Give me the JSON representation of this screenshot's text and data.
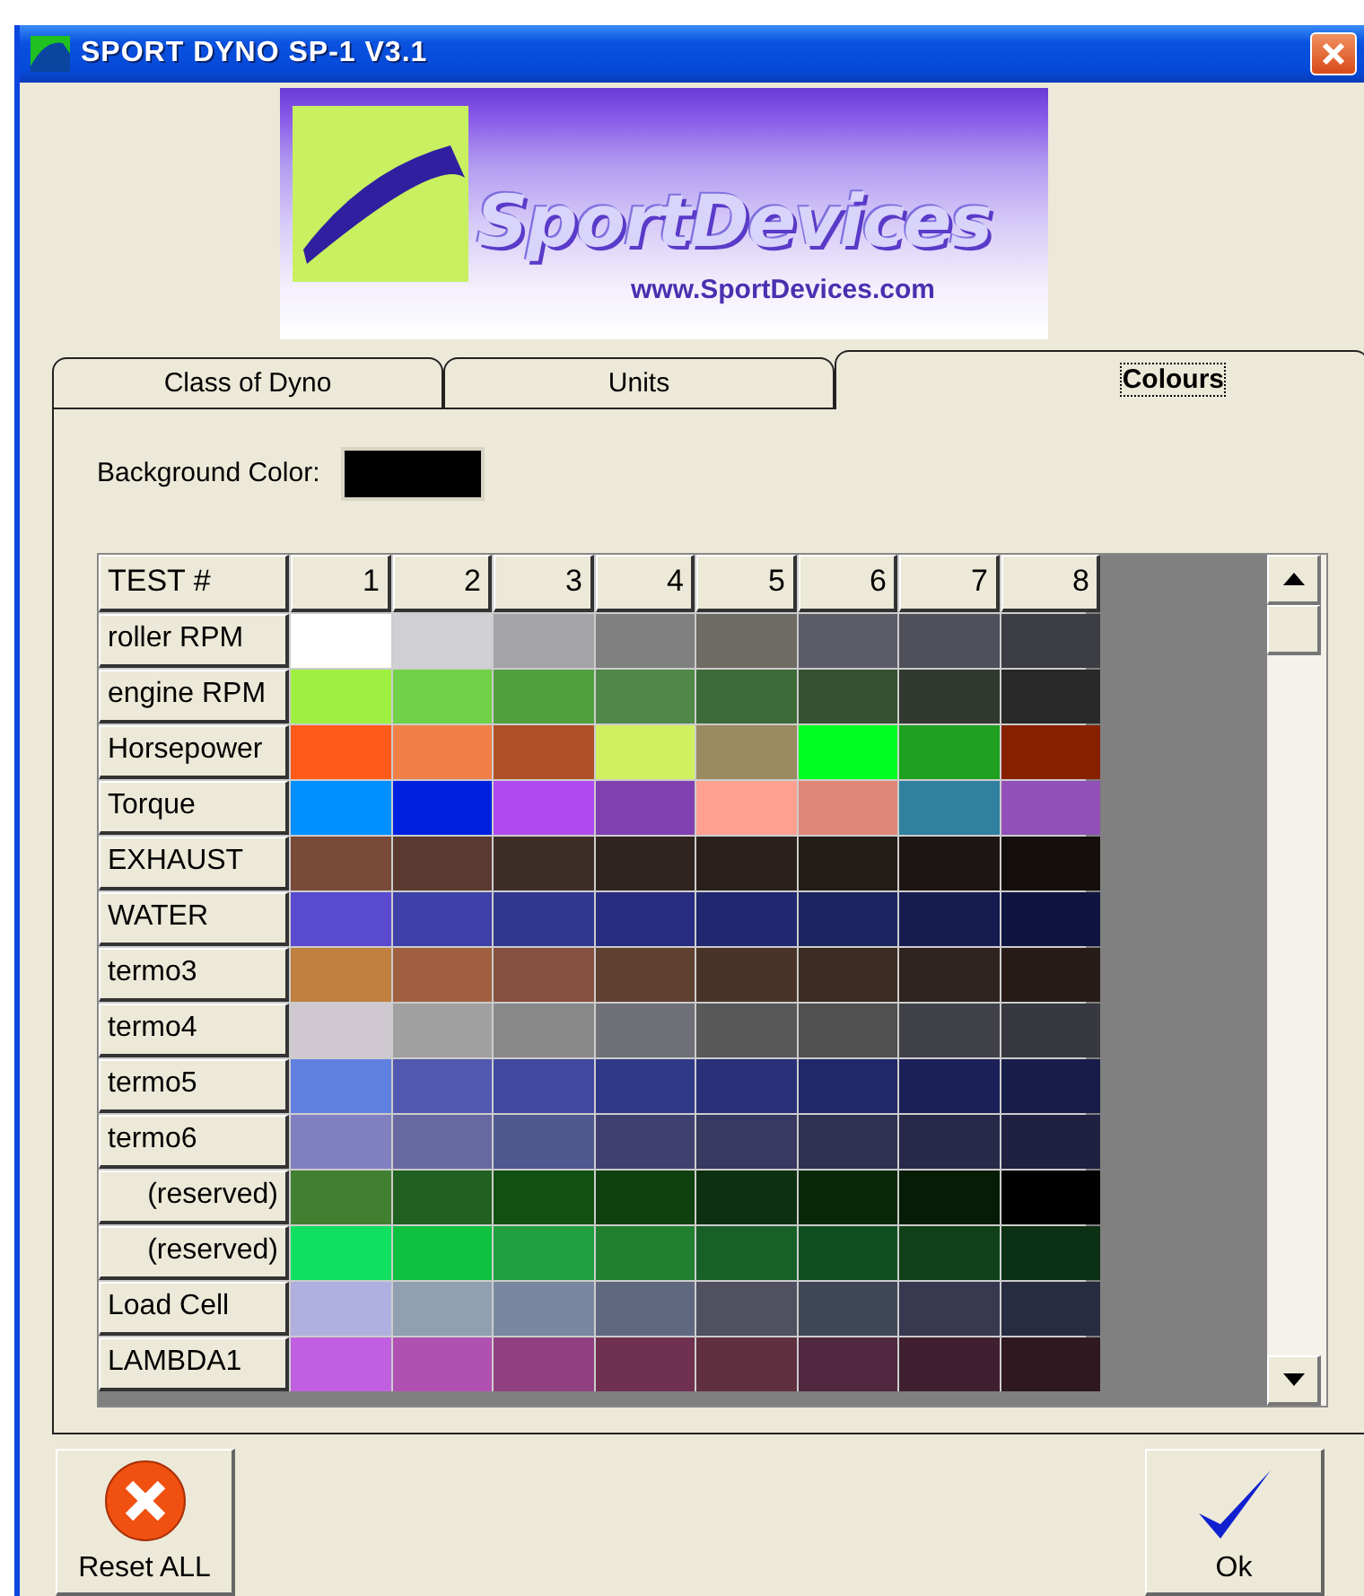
{
  "window": {
    "title": "SPORT DYNO SP-1 V3.1"
  },
  "logo": {
    "name": "SportDevices",
    "url": "www.SportDevices.com"
  },
  "tabs": [
    {
      "label": "Class of Dyno",
      "selected": false
    },
    {
      "label": "Units",
      "selected": false
    },
    {
      "label": "Colours",
      "selected": true
    }
  ],
  "background_color": {
    "label": "Background Color:",
    "color": "#000000"
  },
  "grid": {
    "corner": "TEST #",
    "columns": [
      "1",
      "2",
      "3",
      "4",
      "5",
      "6",
      "7",
      "8"
    ],
    "rows": [
      {
        "label": "roller RPM",
        "cells": [
          {
            "color": "#ffffff"
          },
          {
            "color": "#d0d0d4"
          },
          {
            "color": "#a4a4a8"
          },
          {
            "color": "#808080"
          },
          {
            "color": "#6e6a64"
          },
          {
            "color": "#5c5c68"
          },
          {
            "color": "#50505a"
          },
          {
            "color": "#3c3c44"
          }
        ]
      },
      {
        "label": "engine RPM",
        "cells": [
          {
            "color": "#9ef040"
          },
          {
            "color": "#70d048"
          },
          {
            "color": "#50a040"
          },
          {
            "color": "#508848"
          },
          {
            "color": "#3c6a38"
          },
          {
            "color": "#345030"
          },
          {
            "color": "#303830"
          },
          {
            "color": "#282828"
          }
        ]
      },
      {
        "label": "Horsepower",
        "cells": [
          {
            "color": "#ff5a1a"
          },
          {
            "color": "#f08048"
          },
          {
            "color": "#b05028"
          },
          {
            "color": "#d0f060"
          },
          {
            "color": "#9a8a60"
          },
          {
            "color": "#00ff20"
          },
          {
            "color": "#20a020"
          },
          {
            "color": "#882000"
          }
        ]
      },
      {
        "label": "Torque",
        "cells": [
          {
            "color": "#0090ff"
          },
          {
            "color": "#0020e0"
          },
          {
            "color": "#b048f0"
          },
          {
            "color": "#8040b0"
          },
          {
            "color": "#ffa090"
          },
          {
            "color": "#e08878"
          },
          {
            "color": "#3080a0"
          },
          {
            "color": "#9050b8"
          }
        ]
      },
      {
        "label": "EXHAUST",
        "cells": [
          {
            "color": "#7a4a38"
          },
          {
            "color": "#5a3a30"
          },
          {
            "color": "#3e2e2a"
          },
          {
            "color": "#302420"
          },
          {
            "color": "#2a201c"
          },
          {
            "color": "#241c18"
          },
          {
            "color": "#1e1614"
          },
          {
            "color": "#140e0c"
          }
        ]
      },
      {
        "label": "WATER",
        "cells": [
          {
            "color": "#5a4ad0"
          },
          {
            "color": "#3e40a8"
          },
          {
            "color": "#303890"
          },
          {
            "color": "#282c80"
          },
          {
            "color": "#202870"
          },
          {
            "color": "#1c2460"
          },
          {
            "color": "#161c50"
          },
          {
            "color": "#101440"
          }
        ]
      },
      {
        "label": "termo3",
        "cells": [
          {
            "color": "#c08040"
          },
          {
            "color": "#a06040"
          },
          {
            "color": "#885040"
          },
          {
            "color": "#604030"
          },
          {
            "color": "#4a3428"
          },
          {
            "color": "#3c2c24"
          },
          {
            "color": "#302420"
          },
          {
            "color": "#281c18"
          }
        ]
      },
      {
        "label": "termo4",
        "cells": [
          {
            "color": "#d0c8d0"
          },
          {
            "color": "#a0a0a0"
          },
          {
            "color": "#888888"
          },
          {
            "color": "#707078"
          },
          {
            "color": "#585858"
          },
          {
            "color": "#505050"
          },
          {
            "color": "#404048"
          },
          {
            "color": "#383840"
          }
        ]
      },
      {
        "label": "termo5",
        "cells": [
          {
            "color": "#6080e0"
          },
          {
            "color": "#5058b0"
          },
          {
            "color": "#4048a0"
          },
          {
            "color": "#303888"
          },
          {
            "color": "#283078"
          },
          {
            "color": "#202868"
          },
          {
            "color": "#1c2058"
          },
          {
            "color": "#181c48"
          }
        ]
      },
      {
        "label": "termo6",
        "cells": [
          {
            "color": "#8080c0"
          },
          {
            "color": "#6868a0"
          },
          {
            "color": "#505890"
          },
          {
            "color": "#404070"
          },
          {
            "color": "#383860"
          },
          {
            "color": "#303050"
          },
          {
            "color": "#282848"
          },
          {
            "color": "#202040"
          }
        ]
      },
      {
        "label": "(reserved)",
        "cells": [
          {
            "color": "#408030"
          },
          {
            "color": "#206020"
          },
          {
            "color": "#105010"
          },
          {
            "color": "#104010"
          },
          {
            "color": "#0c3010"
          },
          {
            "color": "#082808"
          },
          {
            "color": "#061c06"
          },
          {
            "color": "#000000"
          }
        ]
      },
      {
        "label": "(reserved)",
        "cells": [
          {
            "color": "#10e060"
          },
          {
            "color": "#10c040"
          },
          {
            "color": "#20a040"
          },
          {
            "color": "#208030"
          },
          {
            "color": "#186028"
          },
          {
            "color": "#105020"
          },
          {
            "color": "#104018"
          },
          {
            "color": "#0c3014"
          }
        ]
      },
      {
        "label": "Load Cell",
        "cells": [
          {
            "color": "#b0b0e0"
          },
          {
            "color": "#90a0b0"
          },
          {
            "color": "#7888a0"
          },
          {
            "color": "#606880"
          },
          {
            "color": "#505060"
          },
          {
            "color": "#404858"
          },
          {
            "color": "#383850"
          },
          {
            "color": "#282c40"
          }
        ]
      },
      {
        "label": "LAMBDA1",
        "cells": [
          {
            "color": "#c060e0"
          },
          {
            "color": "#b050b0"
          },
          {
            "color": "#904080"
          },
          {
            "color": "#703050"
          },
          {
            "color": "#603040"
          },
          {
            "color": "#502840"
          },
          {
            "color": "#402030"
          },
          {
            "color": "#301820"
          }
        ]
      }
    ]
  },
  "buttons": [
    {
      "kind": "reset",
      "label": "Reset ALL"
    },
    {
      "kind": "ok",
      "label": "Ok"
    }
  ]
}
